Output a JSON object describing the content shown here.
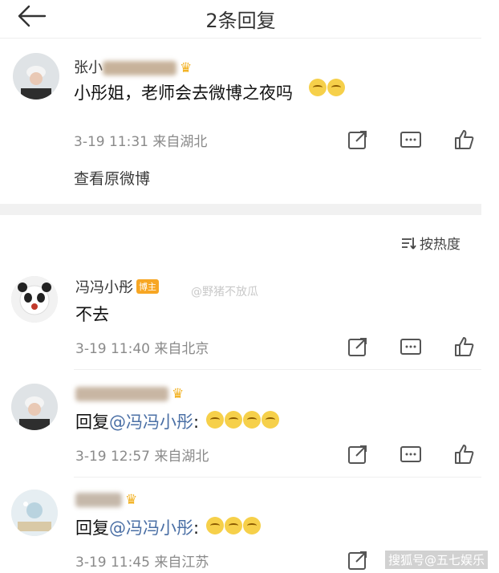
{
  "header": {
    "title": "2条回复"
  },
  "main_comment": {
    "username": "张小",
    "text": "小彤姐，老师会去微博之夜吗",
    "time": "3-19 11:31",
    "location": "来自湖北",
    "view_original": "查看原微博"
  },
  "sort": {
    "label": "按热度"
  },
  "watermark": "@野猪不放瓜",
  "replies": [
    {
      "username": "冯冯小彤",
      "badge": "博主",
      "text": "不去",
      "time": "3-19 11:40",
      "location": "来自北京"
    },
    {
      "username": "",
      "prefix": "回复",
      "mention": "@冯冯小彤",
      "colon": ":",
      "time": "3-19 12:57",
      "location": "来自湖北"
    },
    {
      "username": "",
      "prefix": "回复",
      "mention": "@冯冯小彤",
      "colon": ":",
      "time": "3-19 11:45",
      "location": "来自江苏"
    }
  ],
  "footer_watermark": "搜狐号@五七娱乐",
  "colors": {
    "accent": "#f7a623",
    "link": "#4a6fa5",
    "meta": "#8a8a8a"
  }
}
